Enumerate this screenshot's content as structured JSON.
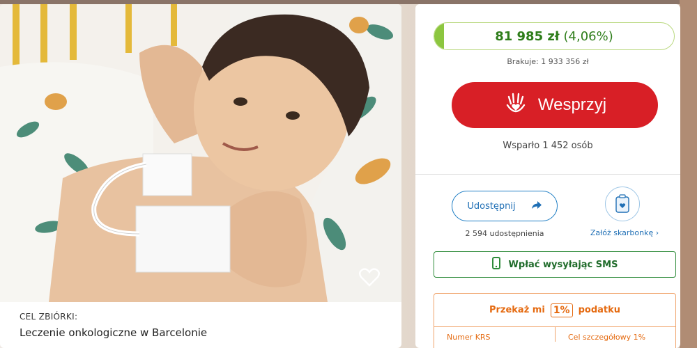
{
  "colors": {
    "accent_red": "#d81f26",
    "progress_green": "#8cc63f",
    "amount_green": "#2e7d1a",
    "link_blue": "#1f6fb5",
    "sms_green": "#2e8b3a",
    "tax_orange": "#e56a10"
  },
  "campaign": {
    "photo_icon": "like-heart-icon",
    "goal_label": "CEL ZBIÓRKI:",
    "goal_text": "Leczenie onkologiczne w Barcelonie"
  },
  "fundraising": {
    "amount": "81 985 zł",
    "percent": "(4,06%)",
    "progress_fraction": 0.0406,
    "missing": "Brakuje: 1 933 356 zł",
    "support_button": "Wesprzyj",
    "support_icon": "heart-hand-icon",
    "supported_by": "Wsparło 1 452 osób"
  },
  "share": {
    "button": "Udostępnij",
    "icon": "share-arrow-icon",
    "count": "2 594 udostępnienia"
  },
  "piggy": {
    "icon": "piggy-bank-icon",
    "link": "Załóż skarbonkę"
  },
  "sms": {
    "icon": "phone-icon",
    "label": "Wpłać wysyłając SMS"
  },
  "tax": {
    "before": "Przekaż mi",
    "pct": "1%",
    "after": "podatku",
    "krs_label": "Numer KRS",
    "goal_label": "Cel szczegółowy 1%"
  }
}
